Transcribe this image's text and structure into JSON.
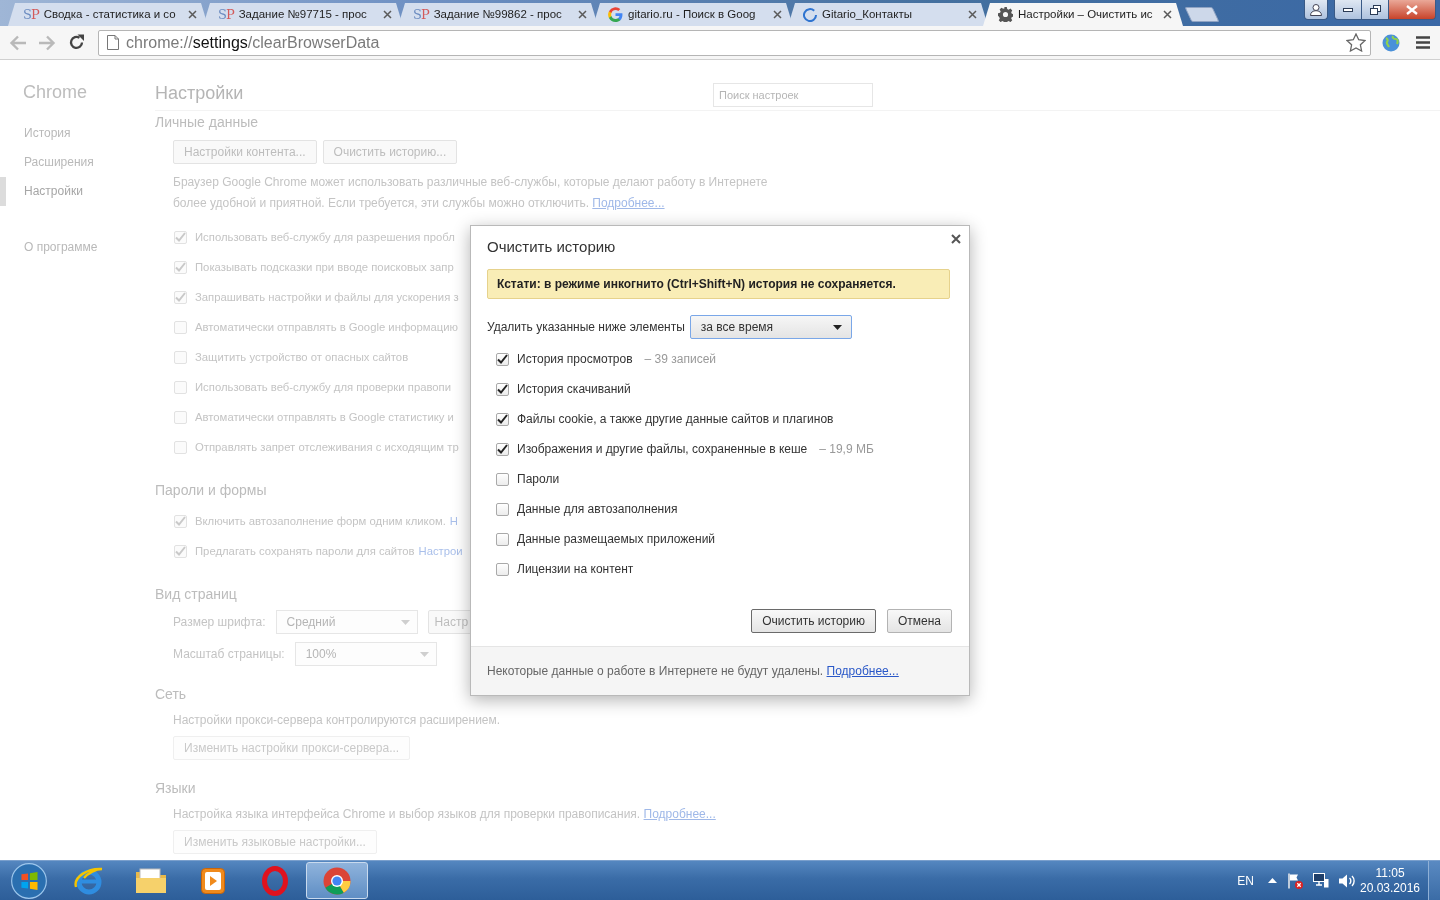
{
  "browser": {
    "tabs": [
      {
        "kind": "letters",
        "logo": "SP",
        "title": "Сводка - статистика и со",
        "selected": false
      },
      {
        "kind": "letters",
        "logo": "SP",
        "title": "Задание №97715 - прос",
        "selected": false
      },
      {
        "kind": "letters",
        "logo": "SP",
        "title": "Задание №99862 - прос",
        "selected": false
      },
      {
        "kind": "search",
        "title": "gitario.ru - Поиск в Goog",
        "selected": false
      },
      {
        "kind": "loading",
        "title": "Gitario_Контакты",
        "selected": false
      },
      {
        "kind": "settings",
        "title": "Настройки – Очистить ис",
        "selected": true
      }
    ],
    "address": {
      "scheme": "chrome://",
      "host": "settings",
      "path": "/clearBrowserData"
    }
  },
  "sidebar": {
    "title": "Chrome",
    "groups": [
      {
        "items": [
          {
            "label": "История",
            "selected": false
          },
          {
            "label": "Расширения",
            "selected": false
          },
          {
            "label": "Настройки",
            "selected": true
          }
        ]
      },
      {
        "items": [
          {
            "label": "О программе",
            "selected": false
          }
        ]
      }
    ]
  },
  "settings": {
    "title": "Настройки",
    "search": {
      "placeholder": "Поиск настроек"
    },
    "sections": [
      {
        "title": "Личные данные",
        "blocks": [
          {
            "kind": "buttons",
            "buttons": [
              {
                "label": "Настройки контента...",
                "disabled": false
              },
              {
                "label": "Очистить историю...",
                "disabled": false
              }
            ]
          },
          {
            "kind": "paragraph",
            "text": "Браузер Google Chrome может использовать различные веб-службы, которые делают работу в Интернете более удобной и приятной. Если требуется, эти службы можно отключить.",
            "link": "Подробнее..."
          },
          {
            "kind": "checkbox",
            "label": "Использовать веб-службу для разрешения пробл",
            "checked": true
          },
          {
            "kind": "checkbox",
            "label": "Показывать подсказки при вводе поисковых запр",
            "checked": true
          },
          {
            "kind": "checkbox",
            "label": "Запрашивать настройки и файлы для ускорения з",
            "checked": true
          },
          {
            "kind": "checkbox",
            "label": "Автоматически отправлять в Google информацию",
            "checked": false
          },
          {
            "kind": "checkbox",
            "label": "Защитить устройство от опасных сайтов",
            "checked": false
          },
          {
            "kind": "checkbox",
            "label": "Использовать веб-службу для проверки правопи",
            "checked": false
          },
          {
            "kind": "checkbox",
            "label": "Автоматически отправлять в Google статистику и",
            "checked": false
          },
          {
            "kind": "checkbox",
            "label": "Отправлять запрет отслеживания с исходящим тр",
            "checked": false
          }
        ]
      },
      {
        "title": "Пароли и формы",
        "blocks": [
          {
            "kind": "checkbox",
            "label": "Включить автозаполнение форм одним кликом.",
            "link": "Н",
            "checked": true
          },
          {
            "kind": "checkbox",
            "label": "Предлагать сохранять пароли для сайтов",
            "link": "Настрои",
            "checked": true
          }
        ]
      },
      {
        "title": "Вид страниц",
        "blocks": [
          {
            "kind": "select",
            "label": "Размер шрифта:",
            "value": "Средний",
            "button": "Настр"
          },
          {
            "kind": "select",
            "label": "Масштаб страницы:",
            "value": "100%"
          }
        ]
      },
      {
        "title": "Сеть",
        "blocks": [
          {
            "kind": "paragraph",
            "text": "Настройки прокси-сервера контролируются расширением."
          },
          {
            "kind": "buttons",
            "buttons": [
              {
                "label": "Изменить настройки прокси-сервера...",
                "disabled": true
              }
            ]
          }
        ]
      },
      {
        "title": "Языки",
        "blocks": [
          {
            "kind": "paragraph",
            "text": "Настройка языка интерфейса Chrome и выбор языков для проверки правописания.",
            "link": "Подробнее..."
          },
          {
            "kind": "buttons",
            "buttons": [
              {
                "label": "Изменить языковые настройки...",
                "disabled": true
              }
            ]
          }
        ]
      }
    ]
  },
  "dialog": {
    "title": "Очистить историю",
    "notice": "Кстати: в режиме инкогнито (Ctrl+Shift+N) история не сохраняется.",
    "range": {
      "label": "Удалить указанные ниже элементы",
      "value": "за все время"
    },
    "items": [
      {
        "label": "История просмотров",
        "detail": "– 39 записей",
        "checked": true
      },
      {
        "label": "История скачиваний",
        "checked": true
      },
      {
        "label": "Файлы cookie, а также другие данные сайтов и плагинов",
        "checked": true
      },
      {
        "label": "Изображения и другие файлы, сохраненные в кеше",
        "detail": "– 19,9 МБ",
        "checked": true
      },
      {
        "label": "Пароли",
        "checked": false
      },
      {
        "label": "Данные для автозаполнения",
        "checked": false
      },
      {
        "label": "Данные размещаемых приложений",
        "checked": false
      },
      {
        "label": "Лицензии на контент",
        "checked": false
      }
    ],
    "buttons": [
      {
        "label": "Очистить историю",
        "kind": "default"
      },
      {
        "label": "Отмена",
        "kind": "normal"
      }
    ],
    "footer": {
      "text": "Некоторые данные о работе в Интернете не будут удалены.",
      "link": "Подробнее..."
    }
  },
  "taskbar": {
    "apps": [
      {
        "kind": "e",
        "selected": false
      },
      {
        "kind": "folder",
        "selected": false
      },
      {
        "kind": "player",
        "selected": false
      },
      {
        "kind": "ring",
        "selected": false
      },
      {
        "kind": "round",
        "selected": true
      }
    ],
    "language": "EN",
    "time": "11:05",
    "date": "20.03.2016"
  }
}
